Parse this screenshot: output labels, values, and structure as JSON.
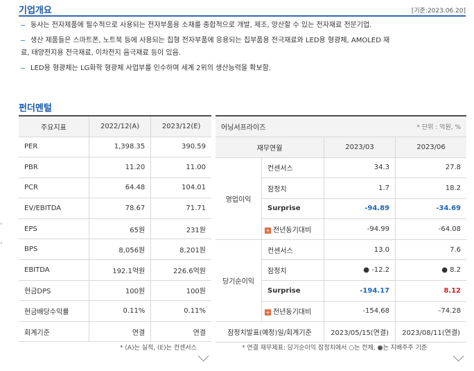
{
  "company": {
    "title": "기업개요",
    "date": "[기준:2023.06.20]",
    "bullets": [
      "동사는 전자제품에 필수적으로 사용되는 전자부품용 소재를 종합적으로 개발, 제조, 양산할 수 있는 전자재료 전문기업.",
      "생산 제품들은 스마트폰, 노트북 등에 사용되는 칩형 전자부품에 응용되는 칩부품용 전극재료와 LED용 형광체, AMOLED 재",
      "료, 태양전지용 전극재료, 이차전지 음극재료 등이 있음.",
      "LED용 형광체는 LG화학 형광체 사업부를 인수하여 세계 2위의 생산능력을 확보함."
    ]
  },
  "fundamental": {
    "title": "펀더멘털",
    "headers": [
      "주요지표",
      "2022/12(A)",
      "2023/12(E)"
    ],
    "rows": [
      [
        "PER",
        "1,398.35",
        "390.59"
      ],
      [
        "PBR",
        "11.20",
        "11.00"
      ],
      [
        "PCR",
        "64.48",
        "104.01"
      ],
      [
        "EV/EBITDA",
        "78.67",
        "71.71"
      ],
      [
        "EPS",
        "65원",
        "231원"
      ],
      [
        "BPS",
        "8,056원",
        "8,201원"
      ],
      [
        "EBITDA",
        "192.1억원",
        "226.6억원"
      ],
      [
        "현금DPS",
        "100원",
        "100원"
      ],
      [
        "현금배당수익률",
        "0.11%",
        "0.11%"
      ],
      [
        "회계기준",
        "연결",
        "연결"
      ]
    ],
    "footnote": "* (A)는 실적, (E)는 컨센서스"
  },
  "earnings": {
    "title": "어닝서프라이즈",
    "unit": "* 단위 : 억원, %",
    "headers": [
      "재무연월",
      "2023/03",
      "2023/06"
    ],
    "group1": "영업이익",
    "group2": "당기순이익",
    "labels": {
      "consensus": "컨센서스",
      "prelim": "잠정치",
      "surprise": "Surprise",
      "yoy": "전년동기대비"
    },
    "op": {
      "consensus": [
        "34.3",
        "27.8"
      ],
      "prelim": [
        "1.7",
        "18.2"
      ],
      "surprise": [
        "-94.89",
        "-34.69"
      ],
      "yoy": [
        "-94.99",
        "-64.08"
      ]
    },
    "net": {
      "consensus": [
        "13.0",
        "7.6"
      ],
      "prelim": [
        "● -12.2",
        "● 8.2"
      ],
      "surprise": [
        "-194.17",
        "8.12"
      ],
      "yoy": [
        "-154.68",
        "-74.28"
      ]
    },
    "announce_label": "잠정치발표(예정)일/회계기준",
    "announce": [
      "2023/05/15(연결)",
      "2023/08/11(연결)"
    ],
    "footnote": "* 연결 재무제표: 당기순이익 잠정치에서 ○는 전체, ●는 지배주주 기준"
  }
}
